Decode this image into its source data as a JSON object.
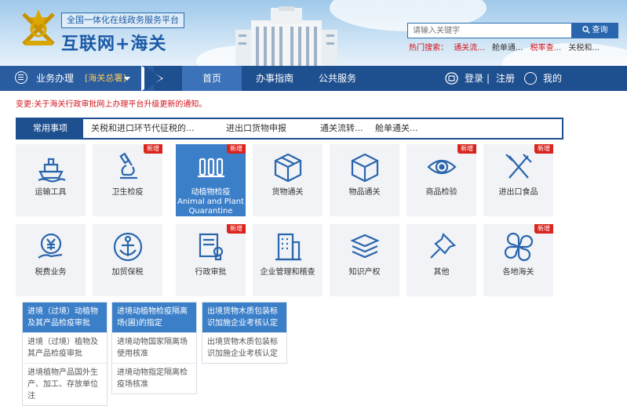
{
  "header": {
    "logo_line1": "全国一体化在线政务服务平台",
    "logo_line2": "互联网+海关",
    "search_placeholder": "请输入关键字",
    "search_button": "查询",
    "hot_label": "热门搜索：",
    "hot_items": [
      "通关流...",
      "舱单通...",
      "税率查...",
      "关税和..."
    ]
  },
  "nav": {
    "business_label": "业务办理",
    "business_scope": "[海关总署]",
    "tabs": [
      "首页",
      "办事指南",
      "公共服务"
    ],
    "login": "登录",
    "divider": "|",
    "register": "注册",
    "mine": "我的"
  },
  "notice": "变更:关于海关行政审批网上办理平台升级更新的通知。",
  "common": {
    "title": "常用事项",
    "items": [
      "关税和进口环节代征税的...",
      "进出口货物申报",
      "通关流转...",
      "舱单通关..."
    ]
  },
  "tiles": {
    "badge_new": "新增",
    "labels": [
      "运输工具",
      "卫生检疫",
      "动植物检疫 Animal and Plant Quarantine",
      "货物通关",
      "物品通关",
      "商品检验",
      "进出口食品",
      "税费业务",
      "加贸保税",
      "行政审批",
      "企业管理和稽查",
      "知识产权",
      "其他",
      "各地海关"
    ]
  },
  "sub_lists": [
    {
      "header": "进境（过境）动植物及其产品检疫审批",
      "items": [
        "进境（过境）植物及其产品检疫审批",
        "进境植物产品国外生产、加工、存放单位注"
      ]
    },
    {
      "header": "进境动植物检疫隔离场(圃)的指定",
      "items": [
        "进境动物国家隔离场使用核准",
        "进境动物指定隔离检疫场核准"
      ]
    },
    {
      "header": "出境货物木质包装标识加施企业考核认定",
      "items": [
        "出境货物木质包装标识加施企业考核认定"
      ]
    }
  ],
  "colors": {
    "nav_blue": "#1e4f8f",
    "accent_blue": "#3b7fc9",
    "badge_red": "#d9251d",
    "notice_red": "#d3141c"
  }
}
